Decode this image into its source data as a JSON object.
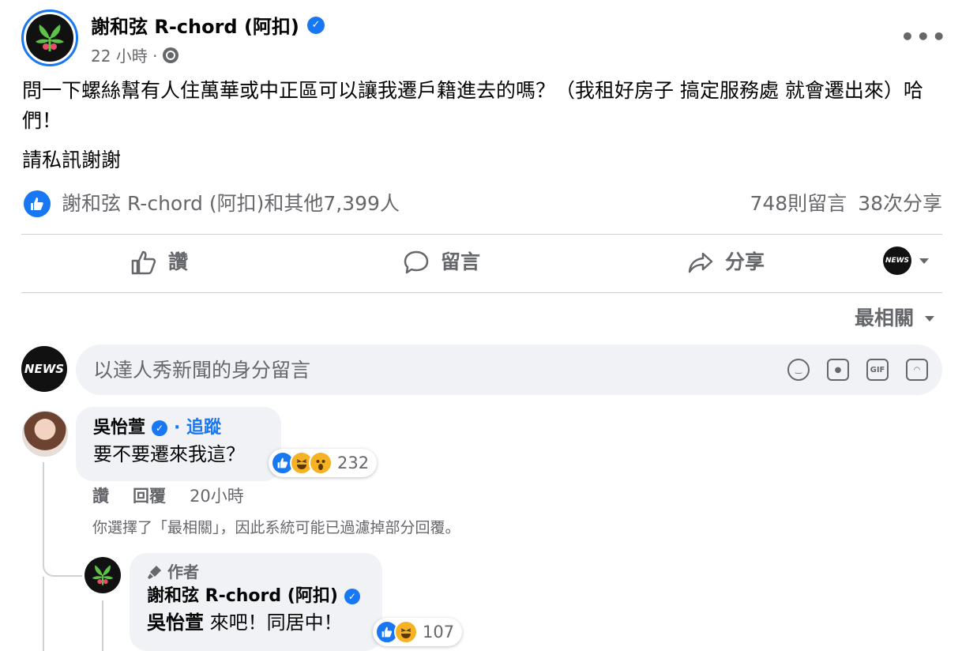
{
  "post": {
    "author": "謝和弦 R-chord (阿扣)",
    "verified_icon": "verified-badge-icon",
    "time": "22 小時 ·",
    "audience_icon": "globe-icon",
    "more": "•••",
    "text_line": "問一下螺絲幫有人住萬華或中正區可以讓我遷戶籍進去的嗎？（我租好房子 搞定服務處 就會遷出來）哈們！",
    "text_line2": "請私訊謝謝"
  },
  "summary": {
    "reactors": "謝和弦 R-chord (阿扣)和其他7,399人",
    "comments": "748則留言",
    "shares": "38次分享"
  },
  "actions": {
    "like": "讚",
    "comment": "留言",
    "share": "分享",
    "page_badge": "NEWS"
  },
  "sort": {
    "label": "最相關"
  },
  "composer": {
    "avatar_text": "NEWS",
    "placeholder": "以達人秀新聞的身分留言",
    "icons": [
      "emoji-icon",
      "camera-icon",
      "gif-icon",
      "sticker-icon"
    ],
    "gif_label": "GIF"
  },
  "comments": [
    {
      "name": "吳怡萱",
      "follow": "· 追蹤",
      "text": "要不要遷來我這？",
      "reaction_count": "232",
      "reactions": [
        "like",
        "haha",
        "wow"
      ],
      "like_label": "讚",
      "reply_label": "回覆",
      "time": "20小時",
      "filter_note": "你選擇了「最相關」，因此系統可能已過濾掉部分回覆。"
    }
  ],
  "reply": {
    "author_tag": "作者",
    "name": "謝和弦 R-chord (阿扣)",
    "mention": "吳怡萱",
    "text": " 來吧！同居中！",
    "reaction_count": "107",
    "reactions": [
      "like",
      "haha"
    ]
  },
  "colors": {
    "accent": "#1877f2",
    "secondary_text": "#65676b",
    "bubble_bg": "#f0f2f5",
    "divider": "#ced0d4"
  }
}
